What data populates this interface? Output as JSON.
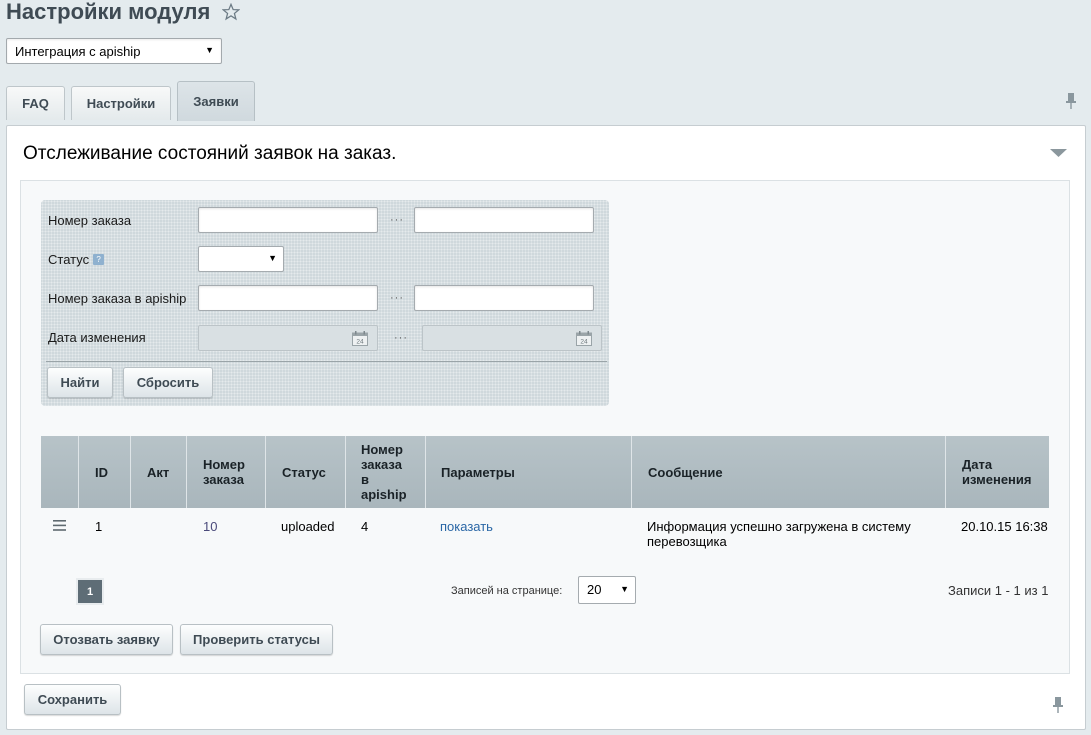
{
  "header": {
    "title": "Настройки модуля",
    "module_select": "Интеграция с apiship"
  },
  "tabs": [
    {
      "label": "FAQ"
    },
    {
      "label": "Настройки"
    },
    {
      "label": "Заявки"
    }
  ],
  "panel": {
    "title": "Отслеживание состояний заявок на заказ."
  },
  "filter": {
    "fields": [
      {
        "label": "Номер заказа",
        "from": "",
        "to": ""
      },
      {
        "label": "Статус",
        "value": ""
      },
      {
        "label": "Номер заказа в apiship",
        "from": "",
        "to": ""
      },
      {
        "label": "Дата изменения",
        "from": "",
        "to": ""
      }
    ],
    "range_sep": "···",
    "find_label": "Найти",
    "reset_label": "Сбросить",
    "help_mark": "?",
    "calendar_text": "24"
  },
  "grid": {
    "columns": [
      "",
      "ID",
      "Акт",
      "Номер заказа",
      "Статус",
      "Номер заказа в apiship",
      "Параметры",
      "Сообщение",
      "Дата изменения"
    ],
    "rows": [
      {
        "id": "1",
        "act": "",
        "order": "10",
        "status": "uploaded",
        "apiship_order": "4",
        "params": "показать",
        "message": "Информация успешно загружена в систему перевозщика",
        "date": "20.10.15 16:38"
      }
    ]
  },
  "pager": {
    "current_page": "1",
    "per_page_label": "Записей на странице:",
    "per_page_value": "20",
    "records": "Записи 1 - 1 из 1"
  },
  "actions": {
    "revoke_label": "Отозвать заявку",
    "check_label": "Проверить статусы",
    "save_label": "Сохранить"
  },
  "colors": {
    "accent_link": "#2a67a6",
    "header_bg": "#b0bdc2",
    "filter_bg": "#cfd8dc"
  }
}
